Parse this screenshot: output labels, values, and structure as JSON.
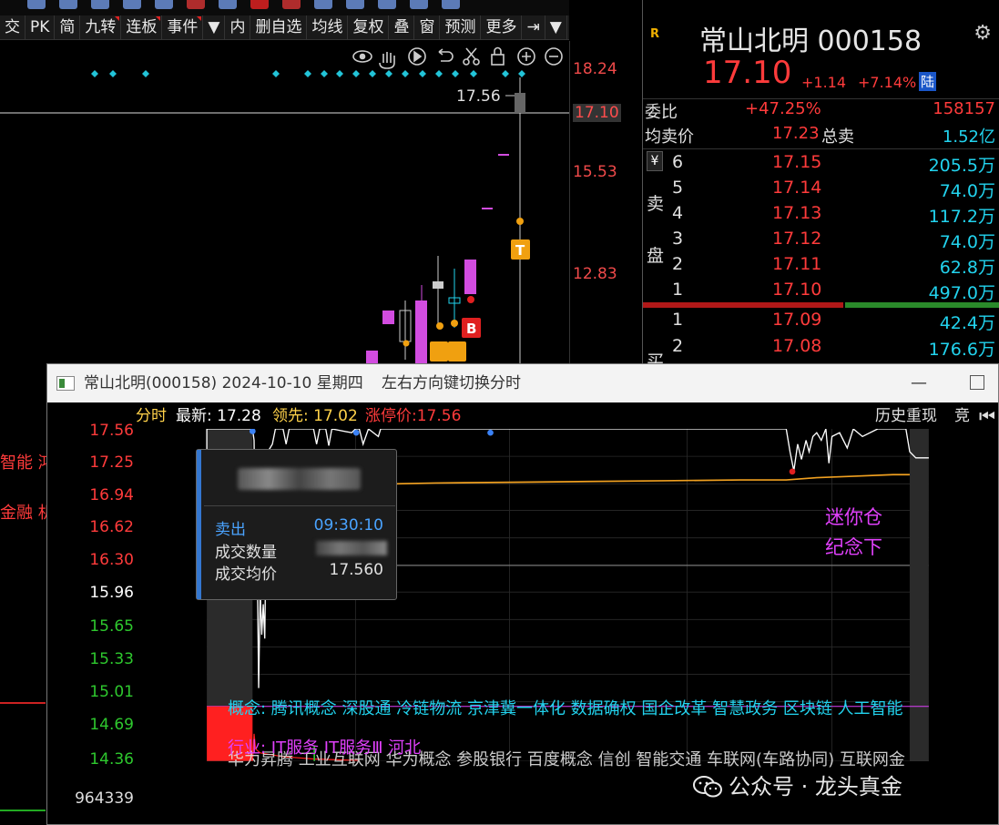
{
  "toolbar": {
    "items": [
      "交",
      "PK",
      "简",
      "九转",
      "连板",
      "事件",
      "▼",
      "内",
      "删自选",
      "均线",
      "复权",
      "叠",
      "窗",
      "预测",
      "更多",
      "⇥",
      "▼"
    ]
  },
  "chart_tools": [
    "eye-icon",
    "hand-icon",
    "play-icon",
    "undo-icon",
    "scissors-icon",
    "lock-icon",
    "zoom-in-icon",
    "zoom-out-icon"
  ],
  "main_chart": {
    "price_labels": [
      "18.24",
      "17.10",
      "15.53",
      "12.83"
    ],
    "current_price_box": "17.10",
    "high_label": "17.56",
    "markers": {
      "T": "T",
      "B": "B"
    }
  },
  "quote": {
    "badge": "R",
    "title": "常山北明 000158",
    "price": "17.10",
    "change": "+1.14",
    "pct": "+7.14%",
    "market": "陆",
    "weibi_label": "委比",
    "weibi_pct": "+47.25%",
    "weibi_val": "158157",
    "avg_sell_label": "均卖价",
    "avg_sell_price": "17.23",
    "total_sell_label": "总卖",
    "total_sell_val": "1.52亿",
    "yen": "¥",
    "sell_side_label": [
      "卖",
      "盘"
    ],
    "asks": [
      {
        "lv": "6",
        "px": "17.15",
        "vol": "205.5万"
      },
      {
        "lv": "5",
        "px": "17.14",
        "vol": "74.0万"
      },
      {
        "lv": "4",
        "px": "17.13",
        "vol": "117.2万"
      },
      {
        "lv": "3",
        "px": "17.12",
        "vol": "74.0万"
      },
      {
        "lv": "2",
        "px": "17.11",
        "vol": "62.8万"
      },
      {
        "lv": "1",
        "px": "17.10",
        "vol": "497.0万"
      }
    ],
    "bids": [
      {
        "lv": "1",
        "px": "17.09",
        "vol": "42.4万"
      },
      {
        "lv": "2",
        "px": "17.08",
        "vol": "176.6万"
      }
    ],
    "buy_side_label": "买"
  },
  "popup": {
    "title": "常山北明(000158) 2024-10-10 星期四",
    "hint": "左右方向键切换分时",
    "minimize": "—",
    "header": {
      "fenshi": "分时",
      "latest": "最新: 17.28",
      "leading": "领先: 17.02",
      "limit_up": "涨停价:17.56",
      "replay": "历史重现",
      "auction": "竞"
    },
    "y_labels_red": [
      "17.56",
      "17.25",
      "16.94",
      "16.62",
      "16.30"
    ],
    "y_label_mid": "15.96",
    "y_labels_green": [
      "15.65",
      "15.33",
      "15.01",
      "14.69",
      "14.36"
    ],
    "tooltip": {
      "action": "卖出",
      "time": "09:30:10",
      "qty_label": "成交数量",
      "avg_label": "成交均价",
      "avg_val": "17.560"
    },
    "annotation": [
      "迷你仓",
      "纪念下"
    ],
    "concepts": "概念:  腾讯概念 深股通 冷链物流 京津冀一体化 数据确权 国企改革 智慧政务 区块链 人工智能",
    "industry": "行业:  IT服务  IT服务Ⅲ  河北",
    "concepts2": "华为昇腾 工业互联网 华为概念 参股银行 百度概念 信创 智能交通 车联网(车路协同) 互联网金",
    "volume": "964339"
  },
  "left_edge_texts": [
    "智能 鸿",
    "金融 机"
  ],
  "watermark": "公众号 · 龙头真金",
  "colors": {
    "red": "#ff3b3b",
    "cyan": "#22d3ee",
    "magenta": "#e040fb",
    "yellow": "#ffd24a",
    "green": "#2ec82e"
  }
}
